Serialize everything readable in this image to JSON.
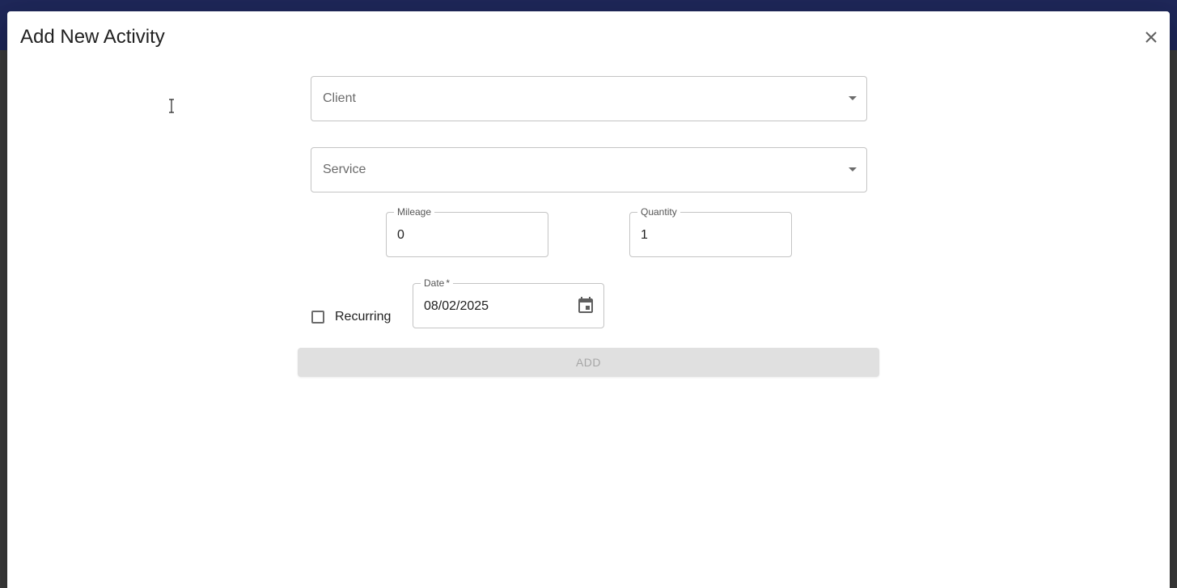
{
  "dialog": {
    "title": "Add New Activity"
  },
  "form": {
    "client": {
      "placeholder": "Client"
    },
    "service": {
      "placeholder": "Service"
    },
    "mileage": {
      "label": "Mileage",
      "value": "0"
    },
    "quantity": {
      "label": "Quantity",
      "value": "1"
    },
    "recurring": {
      "label": "Recurring",
      "checked": false
    },
    "date": {
      "label": "Date",
      "required_mark": "*",
      "value": "08/02/2025"
    },
    "submit_label": "ADD"
  },
  "colors": {
    "app_bar": "#3f51b5",
    "disabled_button_bg": "#e0e0e0",
    "disabled_button_text": "#a6a6a6"
  },
  "icons": {
    "close": "close-icon",
    "dropdown": "arrow-drop-down-icon",
    "calendar": "calendar-icon",
    "cursor": "text-cursor-icon"
  }
}
